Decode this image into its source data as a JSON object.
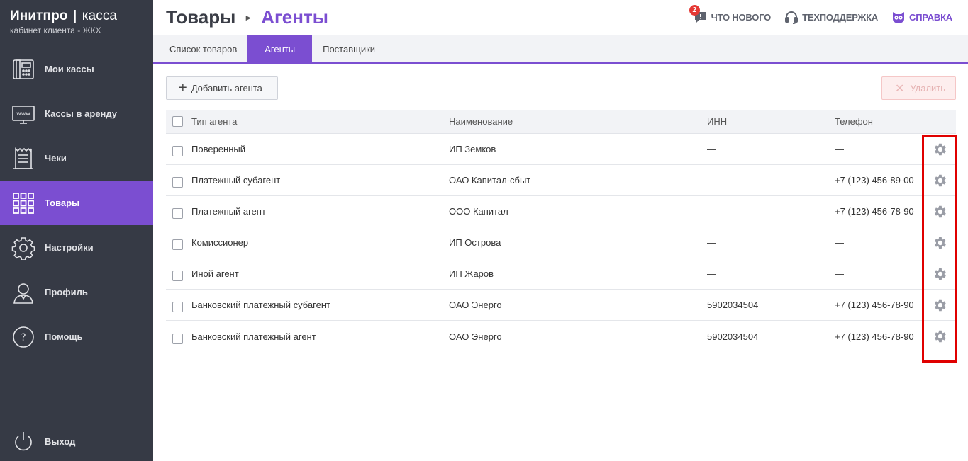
{
  "brand": {
    "title_bold": "Инитпро",
    "title_sep": "|",
    "title_rest": "касса",
    "subtitle": "кабинет клиента - ЖКХ"
  },
  "sidebar": {
    "items": [
      {
        "label": "Мои кассы",
        "icon": "cash-register-icon"
      },
      {
        "label": "Кассы в аренду",
        "icon": "www-monitor-icon"
      },
      {
        "label": "Чеки",
        "icon": "receipt-icon"
      },
      {
        "label": "Товары",
        "icon": "grid-icon",
        "active": true
      },
      {
        "label": "Настройки",
        "icon": "gear-icon"
      },
      {
        "label": "Профиль",
        "icon": "user-icon"
      },
      {
        "label": "Помощь",
        "icon": "question-icon"
      }
    ],
    "logout": {
      "label": "Выход",
      "icon": "power-icon"
    }
  },
  "header": {
    "breadcrumb_parent": "Товары",
    "breadcrumb_separator": "›",
    "breadcrumb_current": "Агенты",
    "news": {
      "label": "Что нового",
      "badge": "2"
    },
    "support": {
      "label": "Техподдержка"
    },
    "help": {
      "label": "Справка"
    }
  },
  "tabs": [
    {
      "label": "Список товаров"
    },
    {
      "label": "Агенты",
      "active": true
    },
    {
      "label": "Поставщики"
    }
  ],
  "toolbar": {
    "add_label": "Добавить агента",
    "add_icon": "+",
    "delete_label": "Удалить",
    "delete_icon": "✕"
  },
  "table": {
    "headers": {
      "type": "Тип агента",
      "name": "Наименование",
      "inn": "ИНН",
      "phone": "Телефон"
    },
    "rows": [
      {
        "type": "Поверенный",
        "name": "ИП Земков",
        "inn": "—",
        "phone": "—"
      },
      {
        "type": "Платежный субагент",
        "name": "ОАО Капитал-сбыт",
        "inn": "—",
        "phone": "+7 (123) 456-89-00"
      },
      {
        "type": "Платежный агент",
        "name": "ООО Капитал",
        "inn": "—",
        "phone": "+7 (123) 456-78-90"
      },
      {
        "type": "Комиссионер",
        "name": "ИП Острова",
        "inn": "—",
        "phone": "—"
      },
      {
        "type": "Иной агент",
        "name": "ИП Жаров",
        "inn": "—",
        "phone": "—"
      },
      {
        "type": "Банковский платежный субагент",
        "name": "ОАО Энерго",
        "inn": "5902034504",
        "phone": "+7 (123) 456-78-90"
      },
      {
        "type": "Банковский платежный агент",
        "name": "ОАО Энерго",
        "inn": "5902034504",
        "phone": "+7 (123) 456-78-90"
      }
    ]
  },
  "colors": {
    "accent": "#7b4ed1",
    "sidebar_bg": "#363a45",
    "highlight": "#e00000"
  }
}
